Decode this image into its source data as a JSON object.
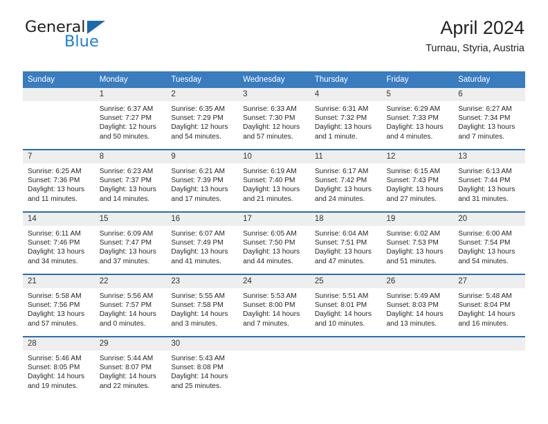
{
  "brand": {
    "name_part1": "General",
    "name_part2": "Blue",
    "accent_color": "#1b7fd4",
    "triangle_color": "#1b69b0"
  },
  "header": {
    "title": "April 2024",
    "subtitle": "Turnau, Styria, Austria"
  },
  "theme": {
    "header_row_bg": "#3a7cc0",
    "week_separator": "#2a6db5",
    "daynum_bg": "#eeeeee"
  },
  "calendar": {
    "weekday_headers": [
      "Sunday",
      "Monday",
      "Tuesday",
      "Wednesday",
      "Thursday",
      "Friday",
      "Saturday"
    ],
    "weeks": [
      [
        {
          "day": "",
          "sunrise": "",
          "sunset": "",
          "daylight": "",
          "daylight2": ""
        },
        {
          "day": "1",
          "sunrise": "Sunrise: 6:37 AM",
          "sunset": "Sunset: 7:27 PM",
          "daylight": "Daylight: 12 hours",
          "daylight2": "and 50 minutes."
        },
        {
          "day": "2",
          "sunrise": "Sunrise: 6:35 AM",
          "sunset": "Sunset: 7:29 PM",
          "daylight": "Daylight: 12 hours",
          "daylight2": "and 54 minutes."
        },
        {
          "day": "3",
          "sunrise": "Sunrise: 6:33 AM",
          "sunset": "Sunset: 7:30 PM",
          "daylight": "Daylight: 12 hours",
          "daylight2": "and 57 minutes."
        },
        {
          "day": "4",
          "sunrise": "Sunrise: 6:31 AM",
          "sunset": "Sunset: 7:32 PM",
          "daylight": "Daylight: 13 hours",
          "daylight2": "and 1 minute."
        },
        {
          "day": "5",
          "sunrise": "Sunrise: 6:29 AM",
          "sunset": "Sunset: 7:33 PM",
          "daylight": "Daylight: 13 hours",
          "daylight2": "and 4 minutes."
        },
        {
          "day": "6",
          "sunrise": "Sunrise: 6:27 AM",
          "sunset": "Sunset: 7:34 PM",
          "daylight": "Daylight: 13 hours",
          "daylight2": "and 7 minutes."
        }
      ],
      [
        {
          "day": "7",
          "sunrise": "Sunrise: 6:25 AM",
          "sunset": "Sunset: 7:36 PM",
          "daylight": "Daylight: 13 hours",
          "daylight2": "and 11 minutes."
        },
        {
          "day": "8",
          "sunrise": "Sunrise: 6:23 AM",
          "sunset": "Sunset: 7:37 PM",
          "daylight": "Daylight: 13 hours",
          "daylight2": "and 14 minutes."
        },
        {
          "day": "9",
          "sunrise": "Sunrise: 6:21 AM",
          "sunset": "Sunset: 7:39 PM",
          "daylight": "Daylight: 13 hours",
          "daylight2": "and 17 minutes."
        },
        {
          "day": "10",
          "sunrise": "Sunrise: 6:19 AM",
          "sunset": "Sunset: 7:40 PM",
          "daylight": "Daylight: 13 hours",
          "daylight2": "and 21 minutes."
        },
        {
          "day": "11",
          "sunrise": "Sunrise: 6:17 AM",
          "sunset": "Sunset: 7:42 PM",
          "daylight": "Daylight: 13 hours",
          "daylight2": "and 24 minutes."
        },
        {
          "day": "12",
          "sunrise": "Sunrise: 6:15 AM",
          "sunset": "Sunset: 7:43 PM",
          "daylight": "Daylight: 13 hours",
          "daylight2": "and 27 minutes."
        },
        {
          "day": "13",
          "sunrise": "Sunrise: 6:13 AM",
          "sunset": "Sunset: 7:44 PM",
          "daylight": "Daylight: 13 hours",
          "daylight2": "and 31 minutes."
        }
      ],
      [
        {
          "day": "14",
          "sunrise": "Sunrise: 6:11 AM",
          "sunset": "Sunset: 7:46 PM",
          "daylight": "Daylight: 13 hours",
          "daylight2": "and 34 minutes."
        },
        {
          "day": "15",
          "sunrise": "Sunrise: 6:09 AM",
          "sunset": "Sunset: 7:47 PM",
          "daylight": "Daylight: 13 hours",
          "daylight2": "and 37 minutes."
        },
        {
          "day": "16",
          "sunrise": "Sunrise: 6:07 AM",
          "sunset": "Sunset: 7:49 PM",
          "daylight": "Daylight: 13 hours",
          "daylight2": "and 41 minutes."
        },
        {
          "day": "17",
          "sunrise": "Sunrise: 6:05 AM",
          "sunset": "Sunset: 7:50 PM",
          "daylight": "Daylight: 13 hours",
          "daylight2": "and 44 minutes."
        },
        {
          "day": "18",
          "sunrise": "Sunrise: 6:04 AM",
          "sunset": "Sunset: 7:51 PM",
          "daylight": "Daylight: 13 hours",
          "daylight2": "and 47 minutes."
        },
        {
          "day": "19",
          "sunrise": "Sunrise: 6:02 AM",
          "sunset": "Sunset: 7:53 PM",
          "daylight": "Daylight: 13 hours",
          "daylight2": "and 51 minutes."
        },
        {
          "day": "20",
          "sunrise": "Sunrise: 6:00 AM",
          "sunset": "Sunset: 7:54 PM",
          "daylight": "Daylight: 13 hours",
          "daylight2": "and 54 minutes."
        }
      ],
      [
        {
          "day": "21",
          "sunrise": "Sunrise: 5:58 AM",
          "sunset": "Sunset: 7:56 PM",
          "daylight": "Daylight: 13 hours",
          "daylight2": "and 57 minutes."
        },
        {
          "day": "22",
          "sunrise": "Sunrise: 5:56 AM",
          "sunset": "Sunset: 7:57 PM",
          "daylight": "Daylight: 14 hours",
          "daylight2": "and 0 minutes."
        },
        {
          "day": "23",
          "sunrise": "Sunrise: 5:55 AM",
          "sunset": "Sunset: 7:58 PM",
          "daylight": "Daylight: 14 hours",
          "daylight2": "and 3 minutes."
        },
        {
          "day": "24",
          "sunrise": "Sunrise: 5:53 AM",
          "sunset": "Sunset: 8:00 PM",
          "daylight": "Daylight: 14 hours",
          "daylight2": "and 7 minutes."
        },
        {
          "day": "25",
          "sunrise": "Sunrise: 5:51 AM",
          "sunset": "Sunset: 8:01 PM",
          "daylight": "Daylight: 14 hours",
          "daylight2": "and 10 minutes."
        },
        {
          "day": "26",
          "sunrise": "Sunrise: 5:49 AM",
          "sunset": "Sunset: 8:03 PM",
          "daylight": "Daylight: 14 hours",
          "daylight2": "and 13 minutes."
        },
        {
          "day": "27",
          "sunrise": "Sunrise: 5:48 AM",
          "sunset": "Sunset: 8:04 PM",
          "daylight": "Daylight: 14 hours",
          "daylight2": "and 16 minutes."
        }
      ],
      [
        {
          "day": "28",
          "sunrise": "Sunrise: 5:46 AM",
          "sunset": "Sunset: 8:05 PM",
          "daylight": "Daylight: 14 hours",
          "daylight2": "and 19 minutes."
        },
        {
          "day": "29",
          "sunrise": "Sunrise: 5:44 AM",
          "sunset": "Sunset: 8:07 PM",
          "daylight": "Daylight: 14 hours",
          "daylight2": "and 22 minutes."
        },
        {
          "day": "30",
          "sunrise": "Sunrise: 5:43 AM",
          "sunset": "Sunset: 8:08 PM",
          "daylight": "Daylight: 14 hours",
          "daylight2": "and 25 minutes."
        },
        {
          "day": "",
          "sunrise": "",
          "sunset": "",
          "daylight": "",
          "daylight2": ""
        },
        {
          "day": "",
          "sunrise": "",
          "sunset": "",
          "daylight": "",
          "daylight2": ""
        },
        {
          "day": "",
          "sunrise": "",
          "sunset": "",
          "daylight": "",
          "daylight2": ""
        },
        {
          "day": "",
          "sunrise": "",
          "sunset": "",
          "daylight": "",
          "daylight2": ""
        }
      ]
    ]
  }
}
